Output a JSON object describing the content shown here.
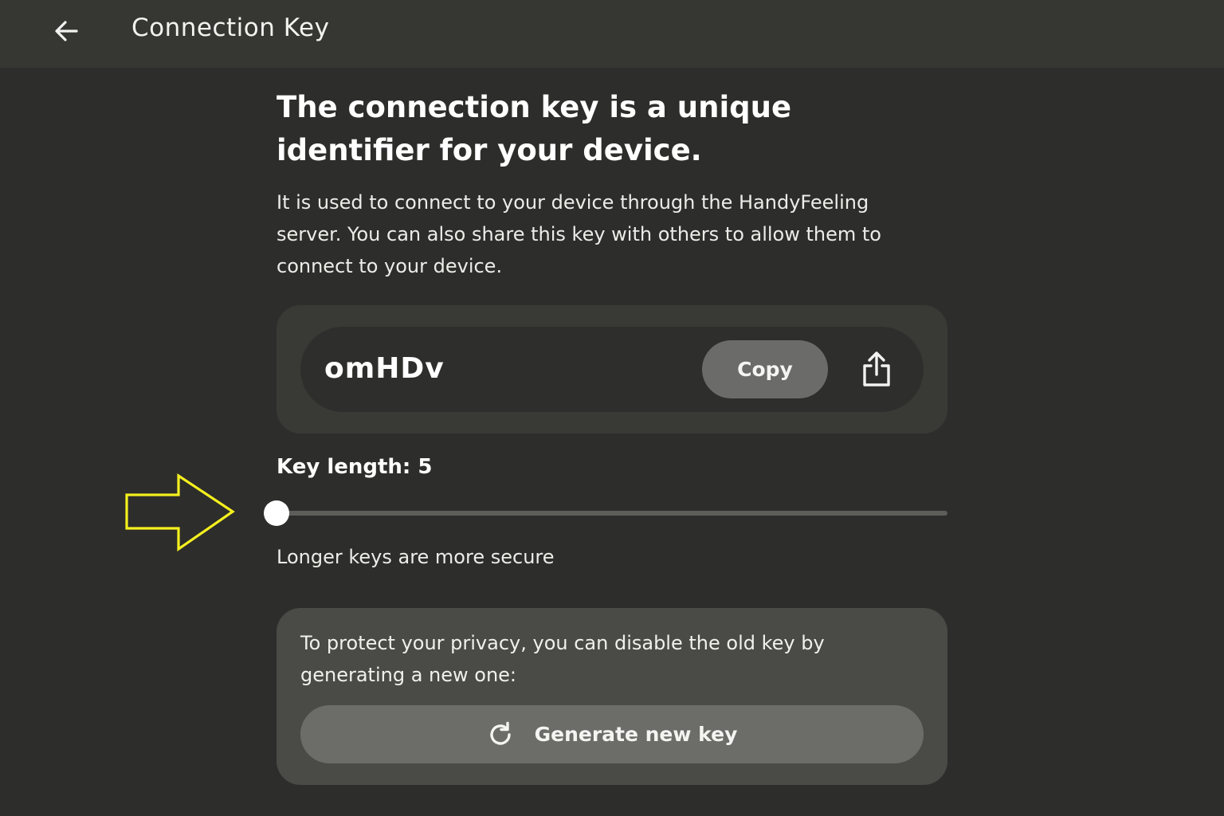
{
  "appbar": {
    "title": "Connection Key",
    "back_icon": "arrow-left-icon"
  },
  "intro": {
    "headline": "The connection key is a unique identifier for your device.",
    "description": "It is used to connect to your device through the HandyFeeling server. You can also share this key with others to allow them to connect to your device."
  },
  "key_card": {
    "key_value": "omHDv",
    "copy_label": "Copy",
    "share_icon": "share-icon"
  },
  "key_length": {
    "label": "Key length: 5",
    "value": 5,
    "min": 5,
    "max": 64,
    "hint": "Longer keys are more secure"
  },
  "annotation": {
    "icon": "arrow-right-icon",
    "color": "#f5f01e"
  },
  "privacy": {
    "text": "To protect your privacy, you can disable the old key by generating a new one:",
    "generate_label": "Generate new key",
    "generate_icon": "refresh-icon"
  },
  "colors": {
    "background": "#2d2d2b",
    "appbar": "#363633",
    "card": "#393936",
    "privacy_card": "#4a4a47",
    "button": "#6b6b69"
  }
}
